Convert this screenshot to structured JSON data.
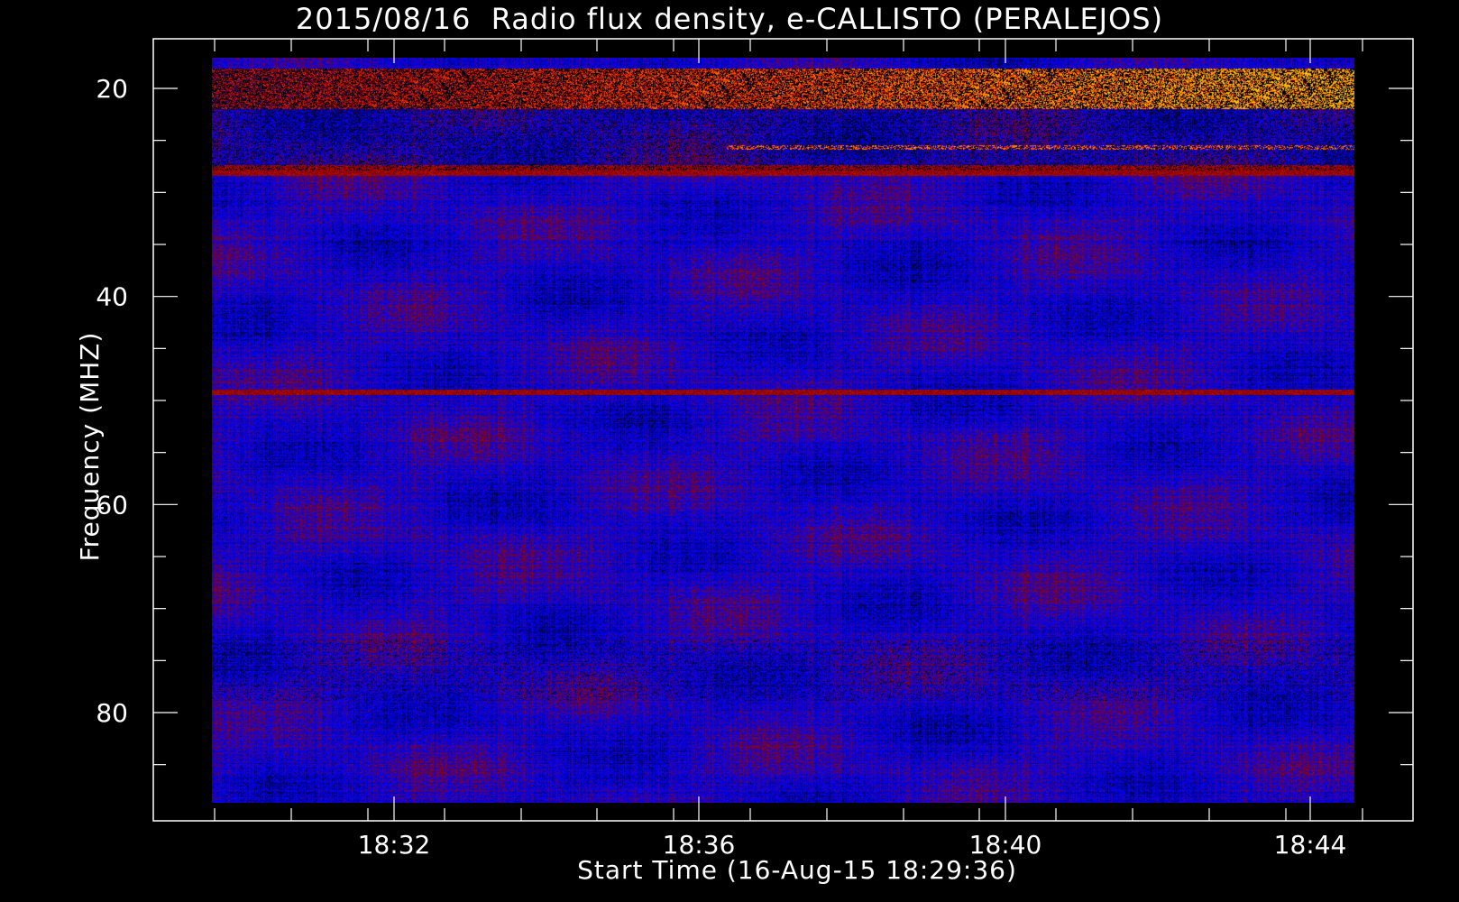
{
  "chart_data": {
    "type": "heatmap",
    "title": "2015/08/16  Radio flux density, e-CALLISTO (PERALEJOS)",
    "xlabel": "Start Time (16-Aug-15 18:29:36)",
    "ylabel": "Frequency (MHZ)",
    "x_range": [
      "18:29:36",
      "18:44:50"
    ],
    "y_range_mhz": [
      17,
      90
    ],
    "y_axis_inverted": true,
    "y_ticks": [
      "20",
      "40",
      "60",
      "80"
    ],
    "y_tick_values": [
      20,
      40,
      60,
      80
    ],
    "x_ticks": [
      "18:32",
      "18:36",
      "18:40",
      "18:44"
    ],
    "colormap": [
      "#000000",
      "#0000ff",
      "#8b0000",
      "#ff3300",
      "#ffcc00"
    ],
    "features": [
      {
        "name": "bright-band",
        "freq_mhz": [
          18,
          22
        ],
        "level": "high"
      },
      {
        "name": "burst-line",
        "freq_mhz": [
          25.5,
          26
        ],
        "level": "high"
      },
      {
        "name": "line",
        "freq_mhz": [
          27.5,
          28.5
        ],
        "level": "medium"
      },
      {
        "name": "line",
        "freq_mhz": [
          49.5,
          50
        ],
        "level": "medium"
      }
    ]
  }
}
